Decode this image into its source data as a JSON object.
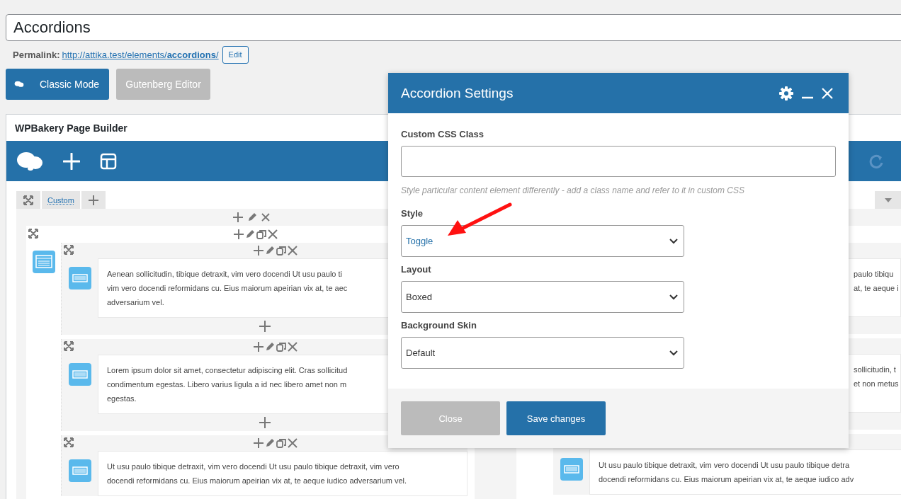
{
  "post_title": "Accordions",
  "permalink": {
    "label": "Permalink:",
    "url": "http://attika.test/elements/**accordions**/",
    "edit_button": "Edit"
  },
  "editor_buttons": [
    {
      "label": "Classic Mode",
      "selected": true
    },
    {
      "label": "Gutenberg Editor",
      "selected": false
    }
  ],
  "builder": {
    "title": "WPBakery Page Builder",
    "tab": "Custom",
    "left_sections": [
      {
        "lines": [
          "Aenean sollicitudin, tibique detraxit, vim vero docendi Ut usu paulo ti",
          "vim vero docendi reformidans cu. Eius maiorum apeirian vix at, te aec",
          "adversarium vel."
        ]
      },
      {
        "lines": [
          "Lorem ipsum dolor sit amet, consectetur adipiscing elit. Cras sollicitud",
          "condimentum egestas. Libero varius ligula a id nec libero amet non m",
          "egestas."
        ]
      },
      {
        "lines": [
          "Ut usu paulo tibique detraxit, vim vero docendi Ut usu paulo tibique detraxit, vim vero",
          "docendi reformidans cu. Eius maiorum apeirian vix at, te aeque iudico adversarium vel."
        ]
      }
    ],
    "right_sections": [
      {
        "kind": "tail",
        "lines": [
          "paulo tibiqu",
          "at, te aeque i"
        ]
      },
      {
        "kind": "tail",
        "lines": [
          "sollicitudin, t",
          "et non metus"
        ]
      },
      {
        "kind": "full",
        "lines": [
          "Ut usu paulo tibique detraxit, vim vero docendi Ut usu paulo tibique detra",
          "docendi reformidans cu. Eius maiorum apeirian vix at, te aeque iudico adv"
        ]
      }
    ]
  },
  "dialog": {
    "title": "Accordion Settings",
    "fields": [
      {
        "kind": "text",
        "label": "Custom CSS Class",
        "help": "Style particular content element differently - add a class name and refer to it in custom CSS"
      },
      {
        "kind": "select",
        "label": "Style",
        "value": "Toggle",
        "focused": true
      },
      {
        "kind": "select",
        "label": "Layout",
        "value": "Boxed",
        "focused": false
      },
      {
        "kind": "select",
        "label": "Background Skin",
        "value": "Default",
        "focused": false
      }
    ],
    "buttons": [
      {
        "label": "Close",
        "kind": "secondary"
      },
      {
        "label": "Save changes",
        "kind": "primary"
      }
    ]
  }
}
